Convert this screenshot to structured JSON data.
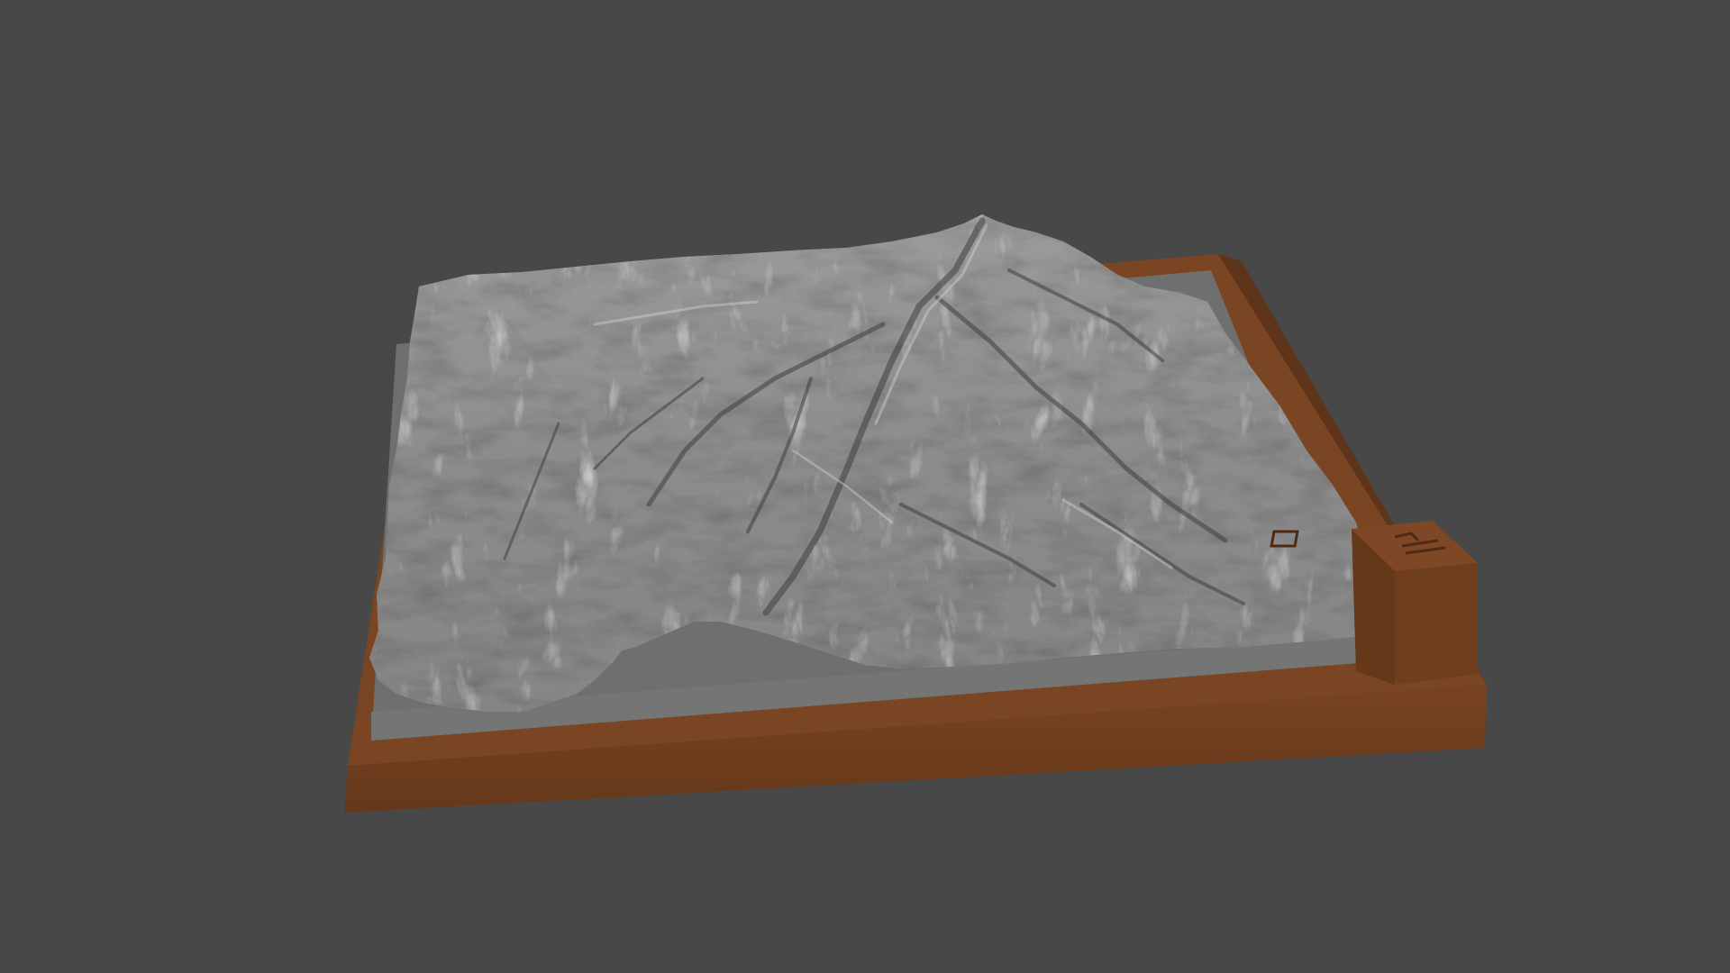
{
  "viewport": {
    "background_color": "#484848"
  },
  "model": {
    "terrain_color": "#8f8f8f",
    "terrain_shadow_color": "#4a4a4a",
    "terrain_highlight_color": "#c4c4c4",
    "plate_color": "#6f6f6f",
    "base_color": "#6b3d1e",
    "base_top_color": "#7a4523",
    "base_shadow_color": "#5a3118"
  },
  "icons": {
    "logo_plaque": "engraved-logo-icon"
  }
}
